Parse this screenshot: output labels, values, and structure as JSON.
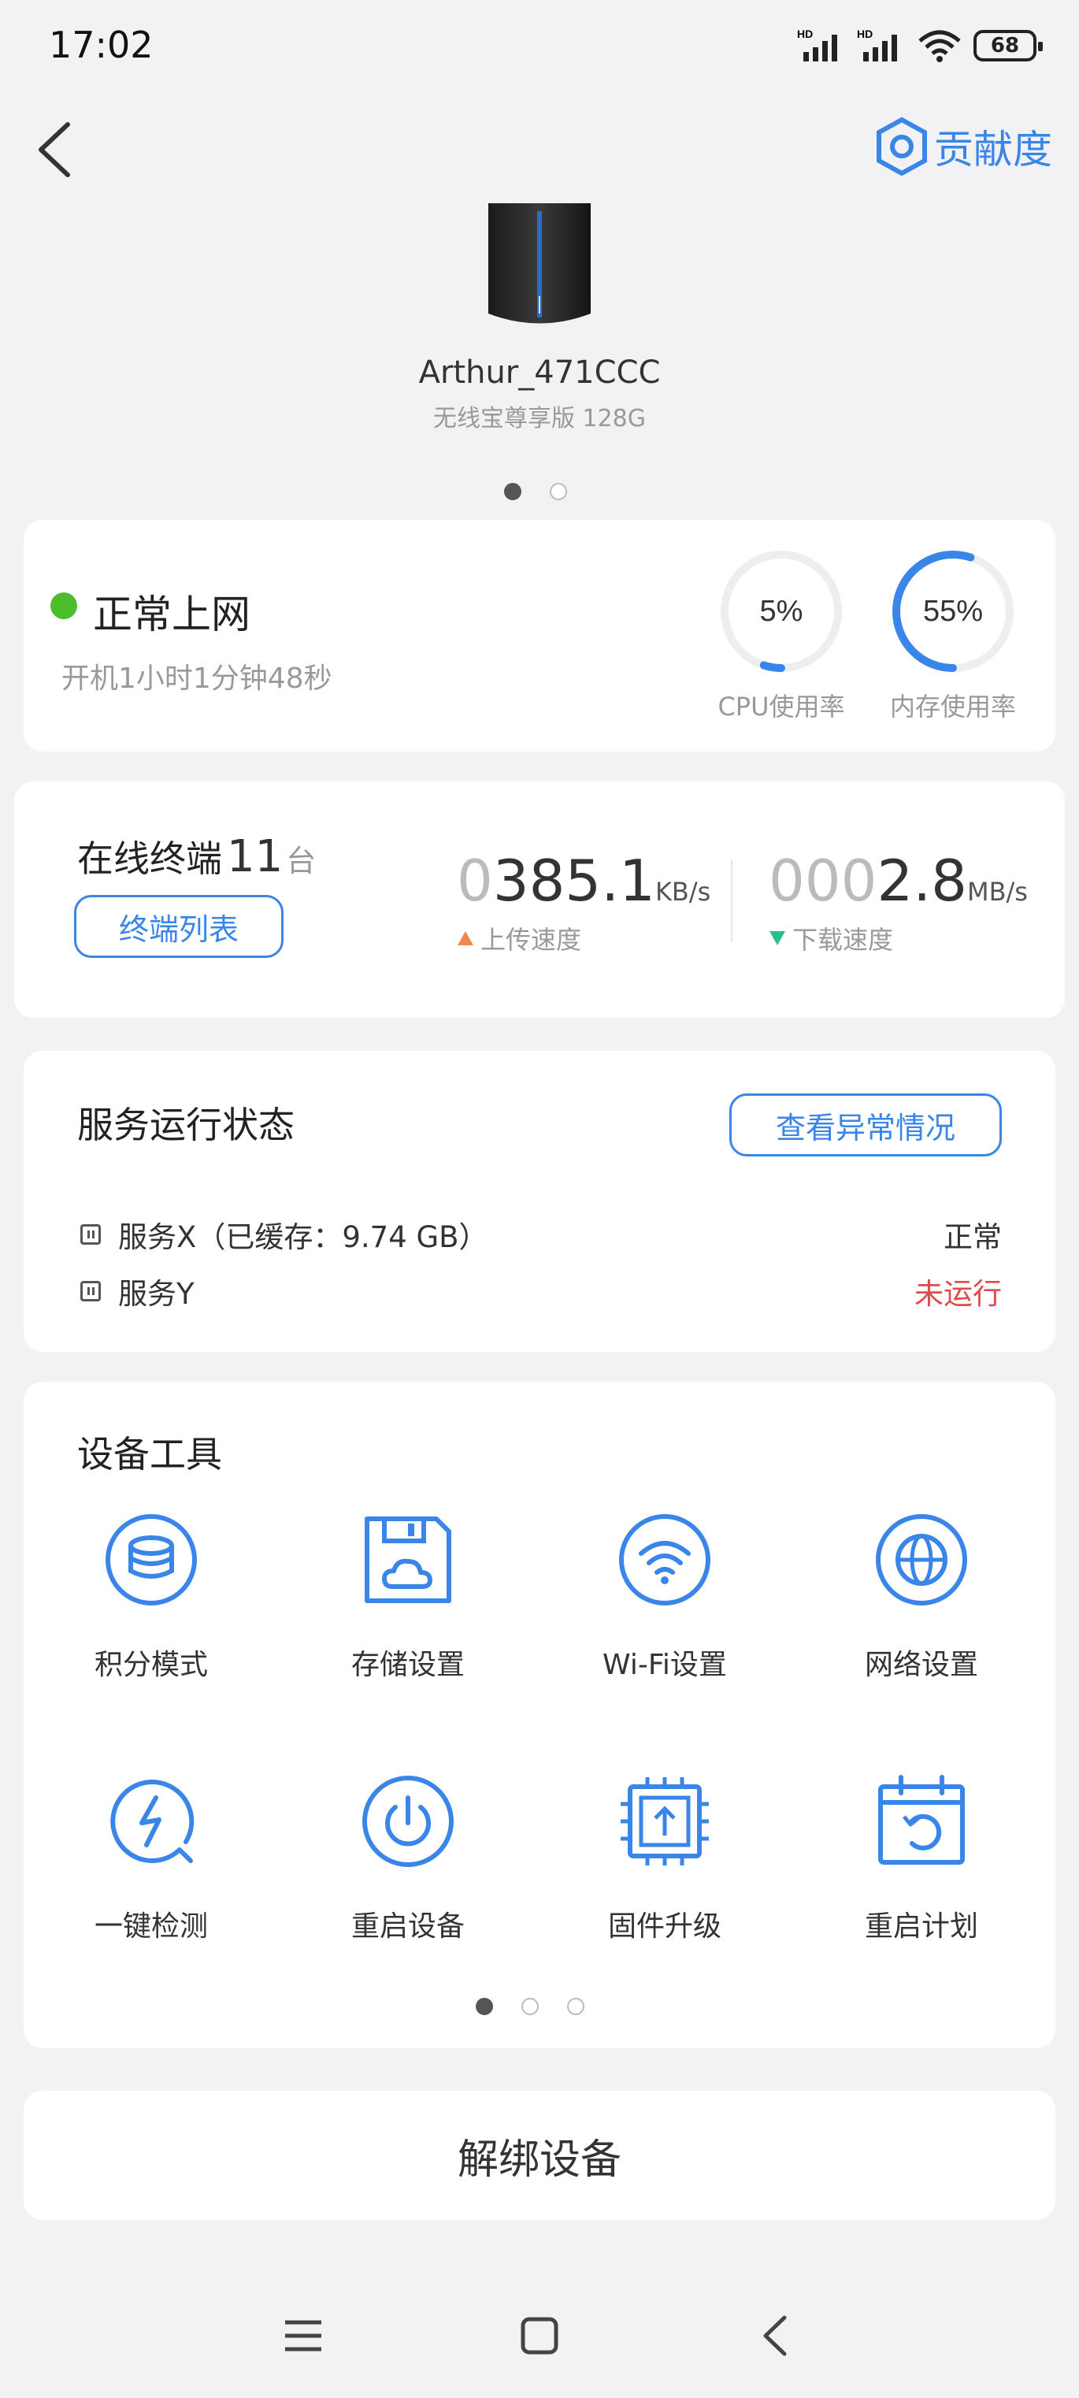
{
  "status_bar": {
    "time": "17:02",
    "battery": "68",
    "sim1_tag": "HD",
    "sim2_tag": "HD"
  },
  "header": {
    "contribution_label": "贡献度"
  },
  "device": {
    "name": "Arthur_471CCC",
    "model": "无线宝尊享版 128G"
  },
  "status_card": {
    "state": "正常上网",
    "uptime": "开机1小时1分钟48秒",
    "cpu": {
      "value": "5%",
      "fraction": 0.05,
      "label": "CPU使用率"
    },
    "memory": {
      "value": "55%",
      "fraction": 0.55,
      "label": "内存使用率"
    }
  },
  "terminals": {
    "label": "在线终端",
    "count": "11",
    "unit": "台",
    "list_button": "终端列表",
    "upload": {
      "leading": "0",
      "value": "385.1",
      "unit": "KB/s",
      "label": "上传速度"
    },
    "download": {
      "leading": "000",
      "value": "2.8",
      "unit": "MB/s",
      "label": "下载速度"
    }
  },
  "services": {
    "title": "服务运行状态",
    "check_button": "查看异常情况",
    "items": [
      {
        "name": "服务X（已缓存：9.74 GB）",
        "status": "正常"
      },
      {
        "name": "服务Y",
        "status": "未运行"
      }
    ]
  },
  "tools": {
    "title": "设备工具",
    "items": [
      {
        "label": "积分模式",
        "icon": "coins-icon"
      },
      {
        "label": "存储设置",
        "icon": "storage-icon"
      },
      {
        "label": "Wi-Fi设置",
        "icon": "wifi-icon"
      },
      {
        "label": "网络设置",
        "icon": "globe-icon"
      },
      {
        "label": "一键检测",
        "icon": "lightning-check-icon"
      },
      {
        "label": "重启设备",
        "icon": "power-icon"
      },
      {
        "label": "固件升级",
        "icon": "chip-upload-icon"
      },
      {
        "label": "重启计划",
        "icon": "calendar-refresh-icon"
      }
    ]
  },
  "unbind": {
    "label": "解绑设备"
  },
  "colors": {
    "accent": "#3a86e8",
    "online": "#4cbe2e",
    "error": "#e04b4b",
    "up_arrow": "#f08a4b",
    "down_arrow": "#2bbf8a"
  }
}
